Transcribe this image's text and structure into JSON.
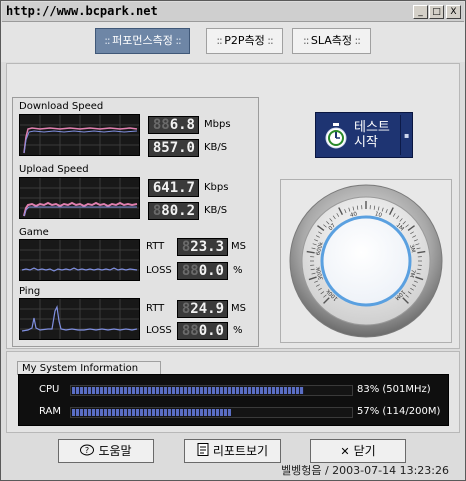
{
  "window": {
    "title": "http://www.bcpark.net",
    "minimize_symbol": "_",
    "maximize_symbol": "□",
    "close_symbol": "X"
  },
  "tabs": [
    {
      "label": "퍼포먼스측정",
      "active": true
    },
    {
      "label": "P2P측정",
      "active": false
    },
    {
      "label": "SLA측정",
      "active": false
    }
  ],
  "download": {
    "label": "Download Speed",
    "mbps": "6.8",
    "mbps_unit": "Mbps",
    "kbs": "857.0",
    "kbs_unit": "KB/S"
  },
  "upload": {
    "label": "Upload  Speed",
    "kbps": "641.7",
    "kbps_unit": "Kbps",
    "kbs": "80.2",
    "kbs_unit": "KB/S"
  },
  "game": {
    "label": "Game",
    "rtt_label": "RTT",
    "rtt": "23.3",
    "rtt_unit": "MS",
    "loss_label": "LOSS",
    "loss": "0.0",
    "loss_unit": "%"
  },
  "ping": {
    "label": "Ping",
    "rtt_label": "RTT",
    "rtt": "24.9",
    "rtt_unit": "MS",
    "loss_label": "LOSS",
    "loss": "0.0",
    "loss_unit": "%"
  },
  "start_button": {
    "line1": "테스트",
    "line2": "시작",
    "icon": "stopwatch-icon"
  },
  "dial": {
    "tick_labels": [
      "100k",
      "300k",
      "600k",
      "07",
      "40",
      "10",
      "1M",
      "3M",
      "7M",
      "10M"
    ],
    "icon": "speedometer-dial"
  },
  "system_info": {
    "title": "My System Information",
    "cpu_label": "CPU",
    "cpu_percent": 83,
    "cpu_text": "83% (501MHz)",
    "ram_label": "RAM",
    "ram_percent": 57,
    "ram_text": "57% (114/200M)"
  },
  "buttons": {
    "help": "도움말",
    "help_icon": "question-icon",
    "report": "리포트보기",
    "report_icon": "report-icon",
    "close": "닫기",
    "close_icon": "close-x-icon"
  },
  "status": "벨벵헝음 / 2003-07-14 13:23:26",
  "colors": {
    "active_tab": "#6e86a6",
    "start_button": "#1e3472",
    "graph_line_pink": "#e080b0",
    "graph_line_blue": "#8090e0",
    "bar_fill": "#5a6ec4"
  }
}
